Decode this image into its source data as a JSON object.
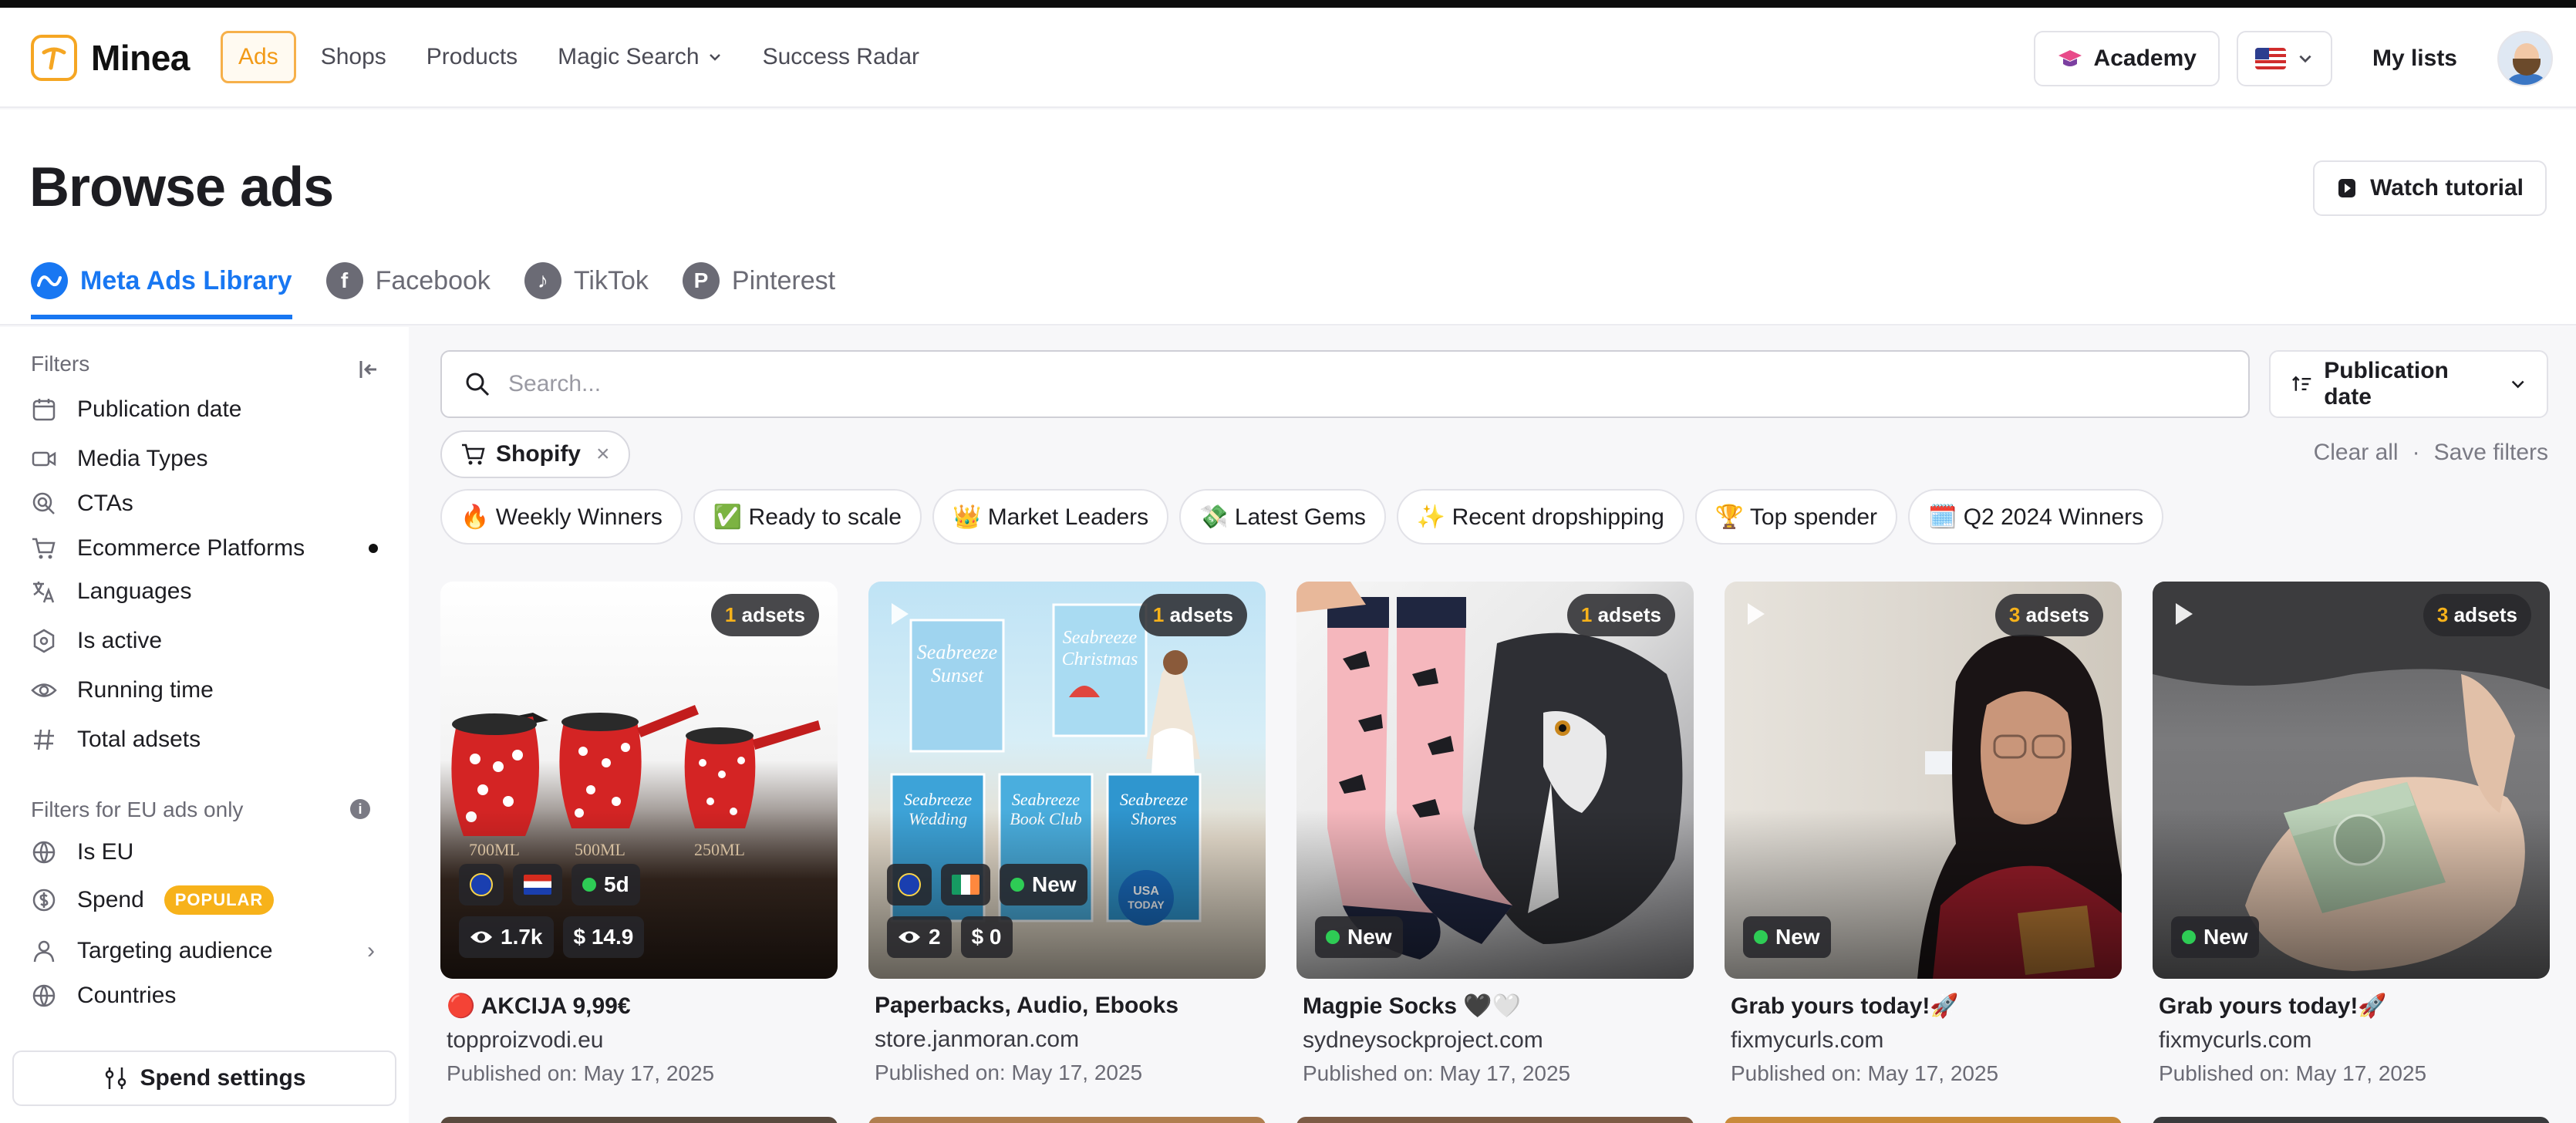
{
  "brand": {
    "name": "Minea"
  },
  "nav": [
    {
      "label": "Ads",
      "active": true
    },
    {
      "label": "Shops"
    },
    {
      "label": "Products"
    },
    {
      "label": "Magic Search",
      "dropdown": true
    },
    {
      "label": "Success Radar"
    }
  ],
  "header": {
    "academy_label": "Academy",
    "mylists_label": "My lists",
    "language_flag": "us-flag-icon"
  },
  "page": {
    "title": "Browse ads",
    "watch_tutorial": "Watch tutorial"
  },
  "tabs": [
    {
      "label": "Meta Ads Library",
      "active": true,
      "icon": "meta-icon"
    },
    {
      "label": "Facebook",
      "icon": "facebook-icon"
    },
    {
      "label": "TikTok",
      "icon": "tiktok-icon"
    },
    {
      "label": "Pinterest",
      "icon": "pinterest-icon"
    }
  ],
  "sidebar": {
    "filters_title": "Filters",
    "items": [
      {
        "label": "Publication date",
        "icon": "calendar-icon"
      },
      {
        "label": "Media Types",
        "icon": "video-icon"
      },
      {
        "label": "CTAs",
        "icon": "cursor-click-icon"
      },
      {
        "label": "Ecommerce Platforms",
        "icon": "cart-icon",
        "active_dot": true
      },
      {
        "label": "Languages",
        "icon": "translate-icon"
      },
      {
        "label": "Is active",
        "icon": "hexagon-check-icon"
      },
      {
        "label": "Running time",
        "icon": "eye-icon"
      },
      {
        "label": "Total adsets",
        "icon": "hash-icon"
      }
    ],
    "eu_title": "Filters for EU ads only",
    "eu_items": [
      {
        "label": "Is EU",
        "icon": "globe-icon"
      },
      {
        "label": "Spend",
        "icon": "dollar-icon",
        "badge": "POPULAR"
      },
      {
        "label": "Targeting audience",
        "icon": "user-icon",
        "chevron": true
      },
      {
        "label": "Countries",
        "icon": "globe-icon"
      }
    ],
    "spend_settings": "Spend settings"
  },
  "search": {
    "placeholder": "Search...",
    "value": ""
  },
  "sort": {
    "label": "Publication date"
  },
  "active_filters": [
    {
      "label": "Shopify",
      "icon": "cart-icon"
    }
  ],
  "filter_actions": {
    "clear": "Clear all",
    "separator": "·",
    "save": "Save filters"
  },
  "collections": [
    "🔥 Weekly Winners",
    "✅ Ready to scale",
    "👑 Market Leaders",
    "💸 Latest Gems",
    "✨ Recent dropshipping",
    "🏆 Top spender",
    "🗓️ Q2 2024 Winners"
  ],
  "cards": [
    {
      "adsets_count": "1",
      "adsets_label": "adsets",
      "flags": [
        "eu",
        "hr"
      ],
      "age": "5d",
      "views": "1.7k",
      "spend": "$ 14.9",
      "title": "🔴 AKCIJA 9,99€",
      "domain": "topproizvodi.eu",
      "published": "Published on: May 17, 2025",
      "video": false
    },
    {
      "adsets_count": "1",
      "adsets_label": "adsets",
      "flags": [
        "eu",
        "ie"
      ],
      "age": "New",
      "views": "2",
      "spend": "$ 0",
      "title": "Paperbacks, Audio, Ebooks",
      "domain": "store.janmoran.com",
      "published": "Published on: May 17, 2025",
      "video": true
    },
    {
      "adsets_count": "1",
      "adsets_label": "adsets",
      "age": "New",
      "title": "Magpie Socks 🖤🤍",
      "domain": "sydneysockproject.com",
      "published": "Published on: May 17, 2025",
      "video": false
    },
    {
      "adsets_count": "3",
      "adsets_label": "adsets",
      "age": "New",
      "title": "Grab yours today!🚀",
      "domain": "fixmycurls.com",
      "published": "Published on: May 17, 2025",
      "video": true
    },
    {
      "adsets_count": "3",
      "adsets_label": "adsets",
      "age": "New",
      "title": "Grab yours today!🚀",
      "domain": "fixmycurls.com",
      "published": "Published on: May 17, 2025",
      "video": true
    }
  ]
}
